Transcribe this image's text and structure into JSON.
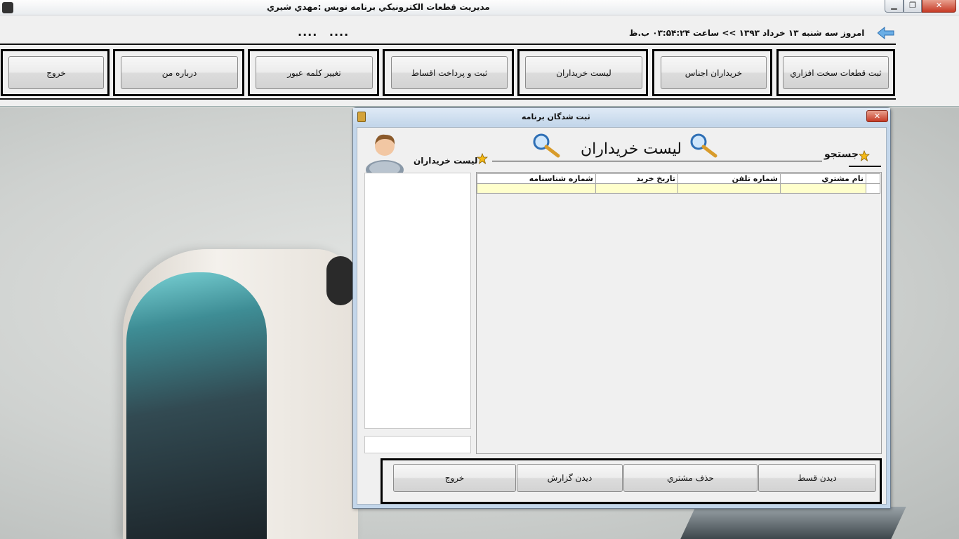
{
  "window": {
    "title": "مديريت قطعات الكترونيكي   برنامه نويس :مهدي شيري",
    "minimize_icon": "minimize-icon",
    "maximize_icon": "maximize-icon",
    "close_icon": "close-icon"
  },
  "header": {
    "info": "امروز سه شنبه ۱۳ خرداد ۱۳۹۳ >> ساعت ۰۳:۵۴:۲۴ ب.ظ",
    "dots": ".... ....",
    "back_icon": "back-arrow-icon",
    "nav": [
      {
        "id": "hardware",
        "label": "ثبت قطعات سخت افزاري"
      },
      {
        "id": "goods-buyers",
        "label": "خريداران اجناس"
      },
      {
        "id": "buyers-list",
        "label": "ليست خريداران"
      },
      {
        "id": "installments",
        "label": "ثبت و پرداخت اقساط"
      },
      {
        "id": "change-password",
        "label": "تغيير كلمه عبور"
      },
      {
        "id": "about",
        "label": "درباره من"
      },
      {
        "id": "exit",
        "label": "خروج"
      }
    ]
  },
  "dialog": {
    "title": "ثبت شدگان برنامه",
    "heading": "ليست خريداران",
    "search_label": "جستجو",
    "buyers_label": "ليست خريداران",
    "grid": {
      "columns": [
        "نام مشتري",
        "شماره تلفن",
        "تاريخ خريد",
        "شماره شناسنامه"
      ],
      "rows": [
        [
          "",
          "",
          "",
          ""
        ]
      ]
    },
    "buttons": {
      "view_installment": "ديدن قسط",
      "delete_customer": "حذف مشتري",
      "view_report": "ديدن گزارش",
      "exit": "خروج"
    }
  },
  "colors": {
    "grid_new_row": "#ffffcc",
    "dialog_frame": "#c3d6ea",
    "close_red": "#c63a25"
  }
}
